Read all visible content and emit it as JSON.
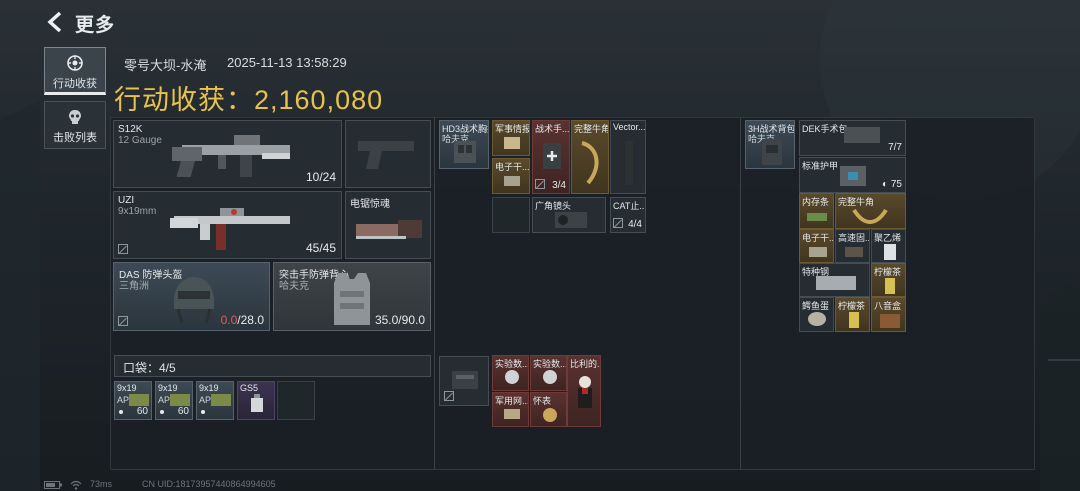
{
  "header": {
    "title": "更多"
  },
  "nav": {
    "tabs": [
      {
        "label": "行动收获",
        "active": true
      },
      {
        "label": "击败列表",
        "active": false
      }
    ]
  },
  "match": {
    "map": "零号大坝-水淹",
    "datetime": "2025-11-13 13:58:29",
    "haul_label": "行动收获：",
    "haul_value": "2,160,080"
  },
  "loadout": {
    "primary": {
      "name": "S12K",
      "caliber": "12 Gauge",
      "ammo": "10/24"
    },
    "secondary": {
      "name": "UZI",
      "caliber": "9x19mm",
      "ammo": "45/45"
    },
    "melee": {
      "name": "电锯惊魂"
    },
    "helmet": {
      "name": "DAS 防弹头盔",
      "sub": "三角洲",
      "dur_current": "0.0",
      "dur_max": "/28.0"
    },
    "armor": {
      "name": "突击手防弹背心",
      "sub": "哈夫克",
      "durability": "35.0/90.0"
    }
  },
  "pocket": {
    "label": "口袋：4/5",
    "items": [
      {
        "name": "9x19",
        "sub": "AP弹",
        "count": "60"
      },
      {
        "name": "9x19",
        "sub": "AP弹",
        "count": "60"
      },
      {
        "name": "9x19",
        "sub": "AP弹",
        "count": ""
      },
      {
        "name": "GS5",
        "sub": "",
        "count": ""
      }
    ]
  },
  "chest_rig": {
    "name": "HD3战术胸挂",
    "sub": "哈夫克",
    "items": [
      {
        "name": "军事情报"
      },
      {
        "name": "战术手..."
      },
      {
        "name": "完整牛角"
      },
      {
        "name": "Vector..."
      },
      {
        "name": "电子干..."
      },
      {
        "name": "3/4"
      },
      {
        "name": "广角镜头"
      },
      {
        "name": "CAT止..."
      },
      {
        "name": "4/4"
      }
    ]
  },
  "backpack_small": {
    "items": [
      {
        "name": "实验数..."
      },
      {
        "name": "实验数..."
      },
      {
        "name": "比利的..."
      },
      {
        "name": "军用网..."
      },
      {
        "name": "怀表"
      }
    ]
  },
  "backpack": {
    "name": "3H战术背包",
    "sub": "哈夫克",
    "items": [
      {
        "name": "DEK手术包",
        "count": "7/7"
      },
      {
        "name": "标准护甲",
        "count": "75"
      },
      {
        "name": "内存条"
      },
      {
        "name": "完整牛角"
      },
      {
        "name": "电子干..."
      },
      {
        "name": "高速固..."
      },
      {
        "name": "聚乙烯"
      },
      {
        "name": "特种钢"
      },
      {
        "name": "柠檬茶"
      },
      {
        "name": "鳄鱼蛋"
      },
      {
        "name": "柠檬茶"
      },
      {
        "name": "八音盒"
      }
    ]
  },
  "footer": {
    "ping": "73ms",
    "uid": "CN UID:18173957440864994605"
  }
}
